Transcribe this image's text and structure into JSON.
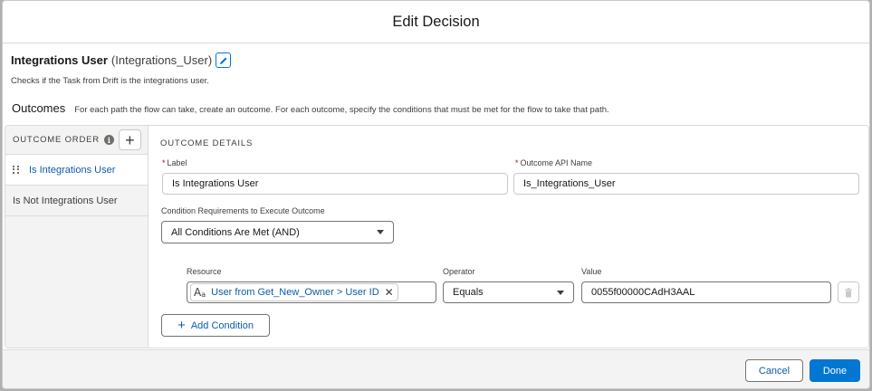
{
  "modal": {
    "title": "Edit Decision"
  },
  "decision": {
    "label": "Integrations User",
    "api_name": "(Integrations_User)",
    "description": "Checks if the Task from Drift is the integrations user."
  },
  "outcomes_section": {
    "heading": "Outcomes",
    "help_text": "For each path the flow can take, create an outcome. For each outcome, specify the conditions that must be met for the flow to take that path."
  },
  "sidebar": {
    "header": "OUTCOME ORDER",
    "add_icon": "plus-icon",
    "info_icon": "info-icon",
    "items": [
      {
        "label": "Is Integrations User",
        "active": true
      },
      {
        "label": "Is Not Integrations User",
        "active": false
      }
    ]
  },
  "outcome_details": {
    "title": "OUTCOME DETAILS",
    "label_field": {
      "label": "Label",
      "required_marker": "*",
      "value": "Is Integrations User"
    },
    "api_field": {
      "label": "Outcome API Name",
      "required_marker": "*",
      "value": "Is_Integrations_User"
    },
    "condition_requirements": {
      "label": "Condition Requirements to Execute Outcome",
      "value": "All Conditions Are Met (AND)"
    },
    "conditions": [
      {
        "resource_header": "Resource",
        "operator_header": "Operator",
        "value_header": "Value",
        "resource_icon_big": "A",
        "resource_icon_small": "a",
        "resource": "User from Get_New_Owner > User ID",
        "operator": "Equals",
        "value": "0055f00000CAdH3AAL"
      }
    ],
    "add_condition_label": "Add Condition"
  },
  "footer": {
    "cancel_label": "Cancel",
    "done_label": "Done"
  },
  "colors": {
    "brand": "#0176d3",
    "link": "#0b5cab",
    "required": "#ba0517"
  }
}
